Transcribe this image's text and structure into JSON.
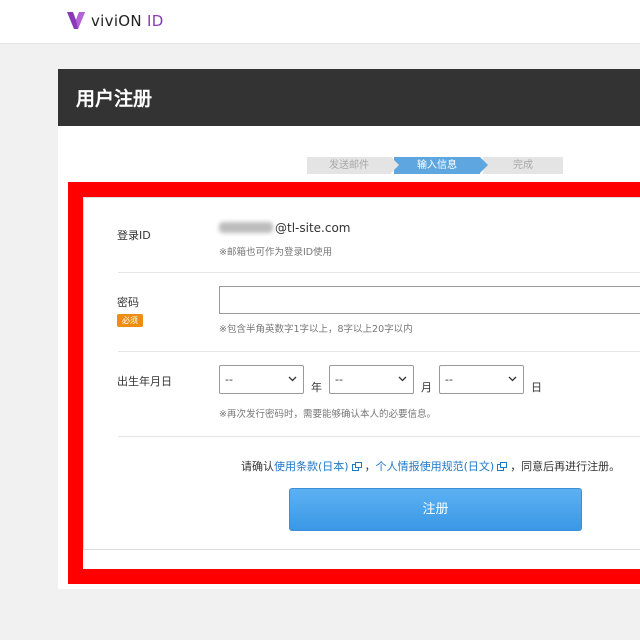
{
  "header": {
    "logo_text_prefix": "viviON",
    "logo_text_suffix": "ID",
    "logo_icon": "v-logo-icon",
    "brand_color": "#8a3ab9"
  },
  "panel": {
    "title": "用户注册"
  },
  "steps": [
    {
      "label": "发送邮件",
      "active": false
    },
    {
      "label": "输入信息",
      "active": true
    },
    {
      "label": "完成",
      "active": false
    }
  ],
  "form": {
    "login_id": {
      "label": "登录ID",
      "value_visible": "@tl-site.com",
      "note": "※邮箱也可作为登录ID使用"
    },
    "password": {
      "label": "密码",
      "required_badge": "必须",
      "value": "",
      "note": "※包含半角英数字1字以上，8字以上20字以内"
    },
    "birthday": {
      "label": "出生年月日",
      "year_select": "--",
      "year_unit": "年",
      "month_select": "--",
      "month_unit": "月",
      "day_select": "--",
      "day_unit": "日",
      "note": "※再次发行密码时，需要能够确认本人的必要信息。"
    },
    "agreement": {
      "prefix": "请确认",
      "terms_link": "使用条款(日本)",
      "separator": "，",
      "privacy_link": "个人情报使用规范(日文)",
      "suffix": "，同意后再进行注册。"
    },
    "submit_label": "注册"
  },
  "colors": {
    "header_dark": "#333333",
    "step_active": "#5ea6df",
    "highlight_frame": "#fe0000",
    "required_badge": "#ee8c13",
    "link": "#1e78c8",
    "button": "#3b98e6"
  }
}
